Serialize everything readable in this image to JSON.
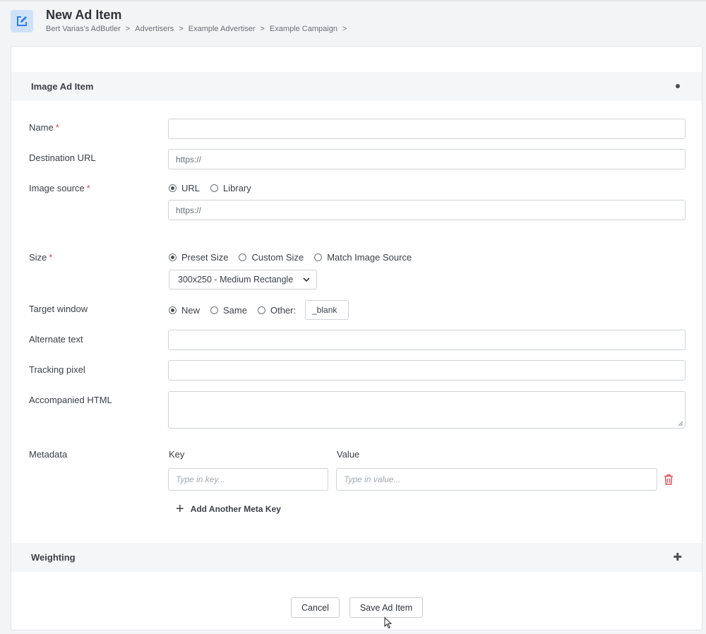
{
  "header": {
    "title": "New Ad Item",
    "icon": "edit-icon",
    "breadcrumb": [
      "Bert Varias's AdButler",
      "Advertisers",
      "Example Advertiser",
      "Example Campaign"
    ],
    "separator": ">"
  },
  "sections": {
    "image_ad_item": "Image Ad Item",
    "weighting": "Weighting"
  },
  "form": {
    "name_label": "Name",
    "destination_label": "Destination URL",
    "destination_value": "https://",
    "image_source_label": "Image source",
    "image_source_options": [
      "URL",
      "Library"
    ],
    "image_source_value": "https://",
    "size_label": "Size",
    "size_options": [
      "Preset Size",
      "Custom Size",
      "Match Image Source"
    ],
    "size_select": "300x250 - Medium Rectangle",
    "target_label": "Target window",
    "target_options": [
      "New",
      "Same",
      "Other:"
    ],
    "target_value": "_blank",
    "alt_label": "Alternate text",
    "tracking_label": "Tracking pixel",
    "html_label": "Accompanied HTML",
    "metadata_label": "Metadata",
    "key_header": "Key",
    "value_header": "Value",
    "key_placeholder": "Type in key...",
    "value_placeholder": "Type in value...",
    "add_meta": "Add Another Meta Key",
    "required_mark": "*"
  },
  "actions": {
    "cancel": "Cancel",
    "save": "Save Ad Item"
  },
  "colors": {
    "accent": "#2f7de0",
    "required": "#e0484f",
    "delete": "#e0484f"
  }
}
